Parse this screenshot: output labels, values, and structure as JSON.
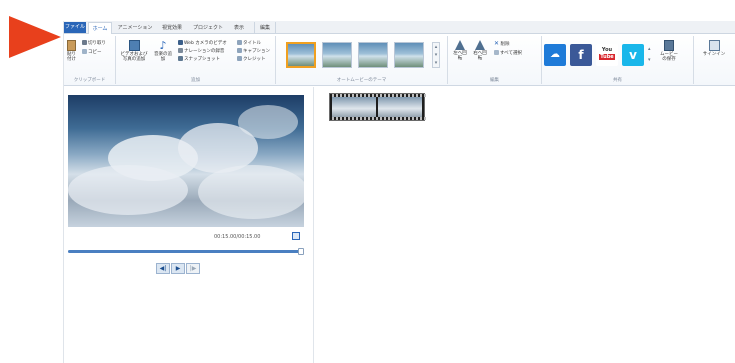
{
  "colors": {
    "accent": "#2a66b8",
    "pointer_arrow": "#e8401c",
    "selection": "#f0a020"
  },
  "tabs": [
    {
      "label": "ファイル",
      "active": false
    },
    {
      "label": "ホーム",
      "active": true
    },
    {
      "label": "アニメーション",
      "active": false
    },
    {
      "label": "視覚効果",
      "active": false
    },
    {
      "label": "プロジェクト",
      "active": false
    },
    {
      "label": "表示",
      "active": false
    },
    {
      "label": "編集",
      "active": false
    }
  ],
  "ribbon": {
    "clipboard": {
      "paste": "貼り付け",
      "cut": "切り取り",
      "copy": "コピー",
      "label": "クリップボード"
    },
    "add": {
      "add_video_photo": "ビデオおよび写真の追加",
      "add_music": "音楽の追加",
      "webcam": "Web カメラのビデオ",
      "narration": "ナレーションの録音",
      "snapshot": "スナップショット",
      "title": "タイトル",
      "caption": "キャプション",
      "credits": "クレジット",
      "label": "追加"
    },
    "themes": {
      "label": "オートムービーのテーマ"
    },
    "editing": {
      "rotate_left": "左へ回転",
      "rotate_right": "右へ回転",
      "remove": "削除",
      "select_all": "すべて選択",
      "label": "編集"
    },
    "share": {
      "label": "共有",
      "youtube_top": "You",
      "youtube_bottom": "Tube",
      "save_movie": "ムービーの保存",
      "sign_in": "サインイン"
    }
  },
  "preview": {
    "timecode": "00:15.00/00:15.00"
  },
  "playback": {
    "progress": 1.0,
    "prev": "◀|",
    "play": "▶",
    "next": "|▶"
  },
  "social_icons": [
    "onedrive-icon",
    "facebook-icon",
    "youtube-icon",
    "vimeo-icon"
  ]
}
